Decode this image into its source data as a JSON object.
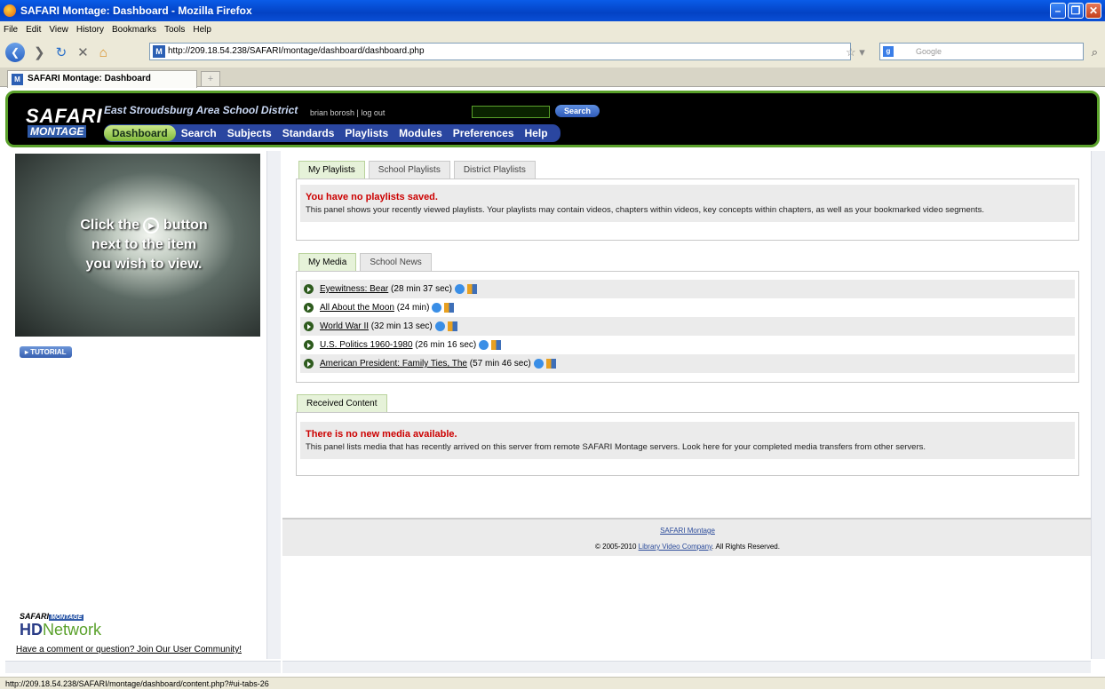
{
  "window": {
    "title": "SAFARI Montage: Dashboard - Mozilla Firefox"
  },
  "menu": [
    "File",
    "Edit",
    "View",
    "History",
    "Bookmarks",
    "Tools",
    "Help"
  ],
  "browser": {
    "url": "http://209.18.54.238/SAFARI/montage/dashboard/dashboard.php",
    "search_placeholder": "Google",
    "tab_title": "SAFARI Montage: Dashboard",
    "favicon": "M"
  },
  "site": {
    "logo_top": "SAFARI",
    "logo_bottom": "MONTAGE",
    "district": "East Stroudsburg Area School District",
    "user": "brian borosh",
    "logout": "log out",
    "search_btn": "Search",
    "nav": [
      "Dashboard",
      "Search",
      "Subjects",
      "Standards",
      "Playlists",
      "Modules",
      "Preferences",
      "Help"
    ]
  },
  "left": {
    "promo_line1": "Click the",
    "promo_line2": "button",
    "promo_line3": "next to the item",
    "promo_line4": "you wish to view.",
    "tutorial": "▸ TUTORIAL",
    "hd_top": "SAFARI",
    "hd_montage": "MONTAGE",
    "hd_main": "HD",
    "hd_network": "Network",
    "community": "Have a comment or question? Join Our User Community!"
  },
  "playlists": {
    "tabs": [
      "My Playlists",
      "School Playlists",
      "District Playlists"
    ],
    "heading": "You have no playlists saved.",
    "text": "This panel shows your recently viewed playlists. Your playlists may contain videos, chapters within videos, key concepts within chapters, as well as your bookmarked video segments."
  },
  "media": {
    "tabs": [
      "My Media",
      "School News"
    ],
    "items": [
      {
        "title": "Eyewitness: Bear",
        "duration": "(28 min 37 sec)"
      },
      {
        "title": "All About the Moon",
        "duration": "(24 min)"
      },
      {
        "title": "World War II",
        "duration": "(32 min 13 sec)"
      },
      {
        "title": "U.S. Politics 1960-1980",
        "duration": "(26 min 16 sec)"
      },
      {
        "title": "American President: Family Ties, The",
        "duration": "(57 min 46 sec)"
      }
    ]
  },
  "received": {
    "tab": "Received Content",
    "heading": "There is no new media available.",
    "text": "This panel lists media that has recently arrived on this server from remote SAFARI Montage servers. Look here for your completed media transfers from other servers."
  },
  "footer": {
    "link": "SAFARI Montage",
    "copyright_pre": "© 2005-2010",
    "company": "Library Video Company",
    "copyright_post": ". All Rights Reserved."
  },
  "status": "http://209.18.54.238/SAFARI/montage/dashboard/content.php?#ui-tabs-26"
}
